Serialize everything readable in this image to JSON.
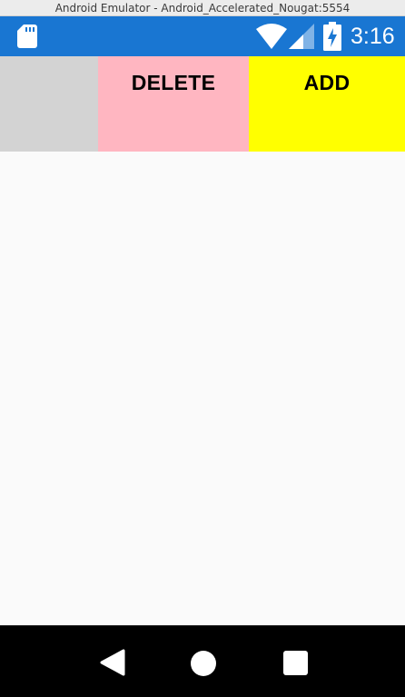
{
  "window": {
    "title": "Android Emulator - Android_Accelerated_Nougat:5554"
  },
  "status_bar": {
    "color": "#1976d2",
    "time": "3:16",
    "icons": [
      "sd-card-icon",
      "wifi-icon",
      "cellular-signal-icon",
      "battery-charging-icon"
    ]
  },
  "toolbar": {
    "spacer_color": "#d3d3d3",
    "delete_label": "DELETE",
    "delete_color": "#ffb6c1",
    "add_label": "ADD",
    "add_color": "#ffff00"
  },
  "nav_bar": {
    "icons": [
      "back-icon",
      "home-icon",
      "recents-icon"
    ]
  }
}
